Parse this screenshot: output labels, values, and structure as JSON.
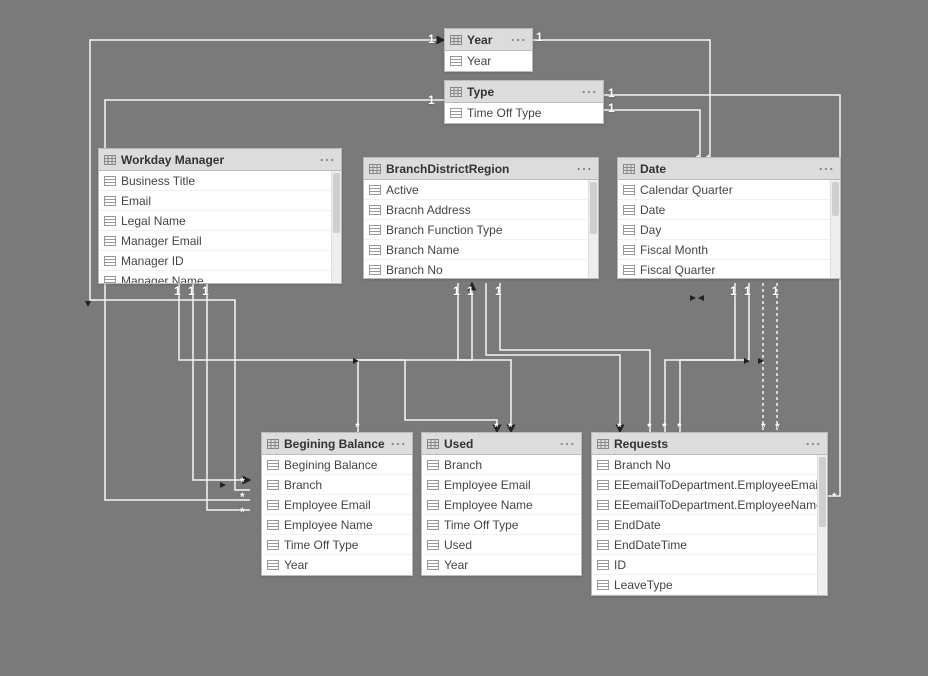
{
  "tables": {
    "year": {
      "title": "Year",
      "fields": [
        "Year"
      ]
    },
    "type": {
      "title": "Type",
      "fields": [
        "Time Off Type"
      ]
    },
    "workday_manager": {
      "title": "Workday Manager",
      "fields": [
        "Business Title",
        "Email",
        "Legal Name",
        "Manager Email",
        "Manager ID",
        "Manager Name"
      ]
    },
    "branch_district_region": {
      "title": "BranchDistrictRegion",
      "fields": [
        "Active",
        "Bracnh Address",
        "Branch Function Type",
        "Branch Name",
        "Branch No"
      ]
    },
    "date": {
      "title": "Date",
      "fields": [
        "Calendar Quarter",
        "Date",
        "Day",
        "Fiscal Month",
        "Fiscal Quarter"
      ]
    },
    "begining_balance": {
      "title": "Begining Balance",
      "fields": [
        "Begining Balance",
        "Branch",
        "Employee Email",
        "Employee Name",
        "Time Off Type",
        "Year"
      ]
    },
    "used": {
      "title": "Used",
      "fields": [
        "Branch",
        "Employee Email",
        "Employee Name",
        "Time Off Type",
        "Used",
        "Year"
      ]
    },
    "requests": {
      "title": "Requests",
      "fields": [
        "Branch No",
        "EEemailToDepartment.EmployeeEmail",
        "EEemailToDepartment.EmployeeName",
        "EndDate",
        "EndDateTime",
        "ID",
        "LeaveType"
      ]
    }
  },
  "cardinality": {
    "one": "1",
    "many": "*"
  }
}
